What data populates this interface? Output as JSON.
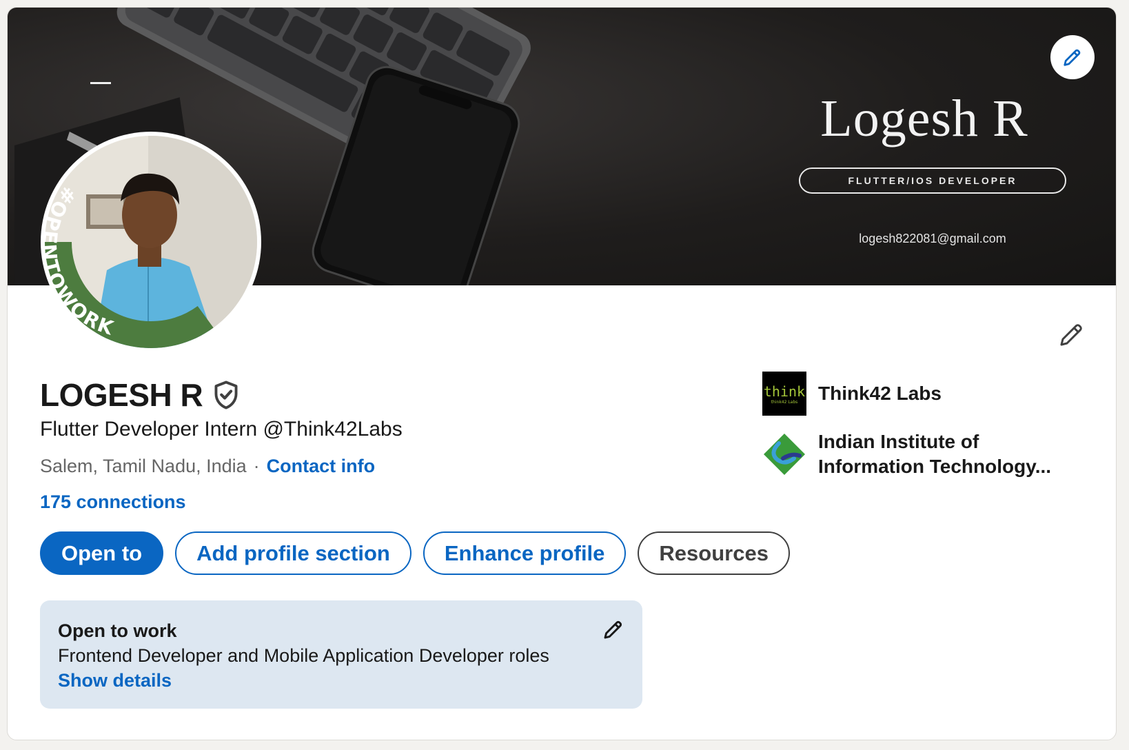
{
  "banner": {
    "name": "Logesh R",
    "role": "FLUTTER/IOS DEVELOPER",
    "email": "logesh822081@gmail.com"
  },
  "avatar": {
    "badge_text": "#OPENTOWORK"
  },
  "profile": {
    "name": "LOGESH R",
    "headline": "Flutter Developer Intern @Think42Labs",
    "location": "Salem, Tamil Nadu, India",
    "separator": "·",
    "contact_info": "Contact info",
    "connections": "175 connections"
  },
  "actions": {
    "open_to": "Open to",
    "add_section": "Add profile section",
    "enhance": "Enhance profile",
    "resources": "Resources"
  },
  "open_to_work": {
    "title": "Open to work",
    "roles": "Frontend Developer and Mobile Application Developer roles",
    "show_details": "Show details"
  },
  "orgs": [
    {
      "name": "Think42 Labs",
      "logo": "think42-logo"
    },
    {
      "name": "Indian Institute of Information Technology...",
      "logo": "iiit-logo"
    }
  ],
  "colors": {
    "accent": "#0a66c2",
    "otw_green": "#3e7a3a",
    "otw_card": "#dde7f1"
  }
}
